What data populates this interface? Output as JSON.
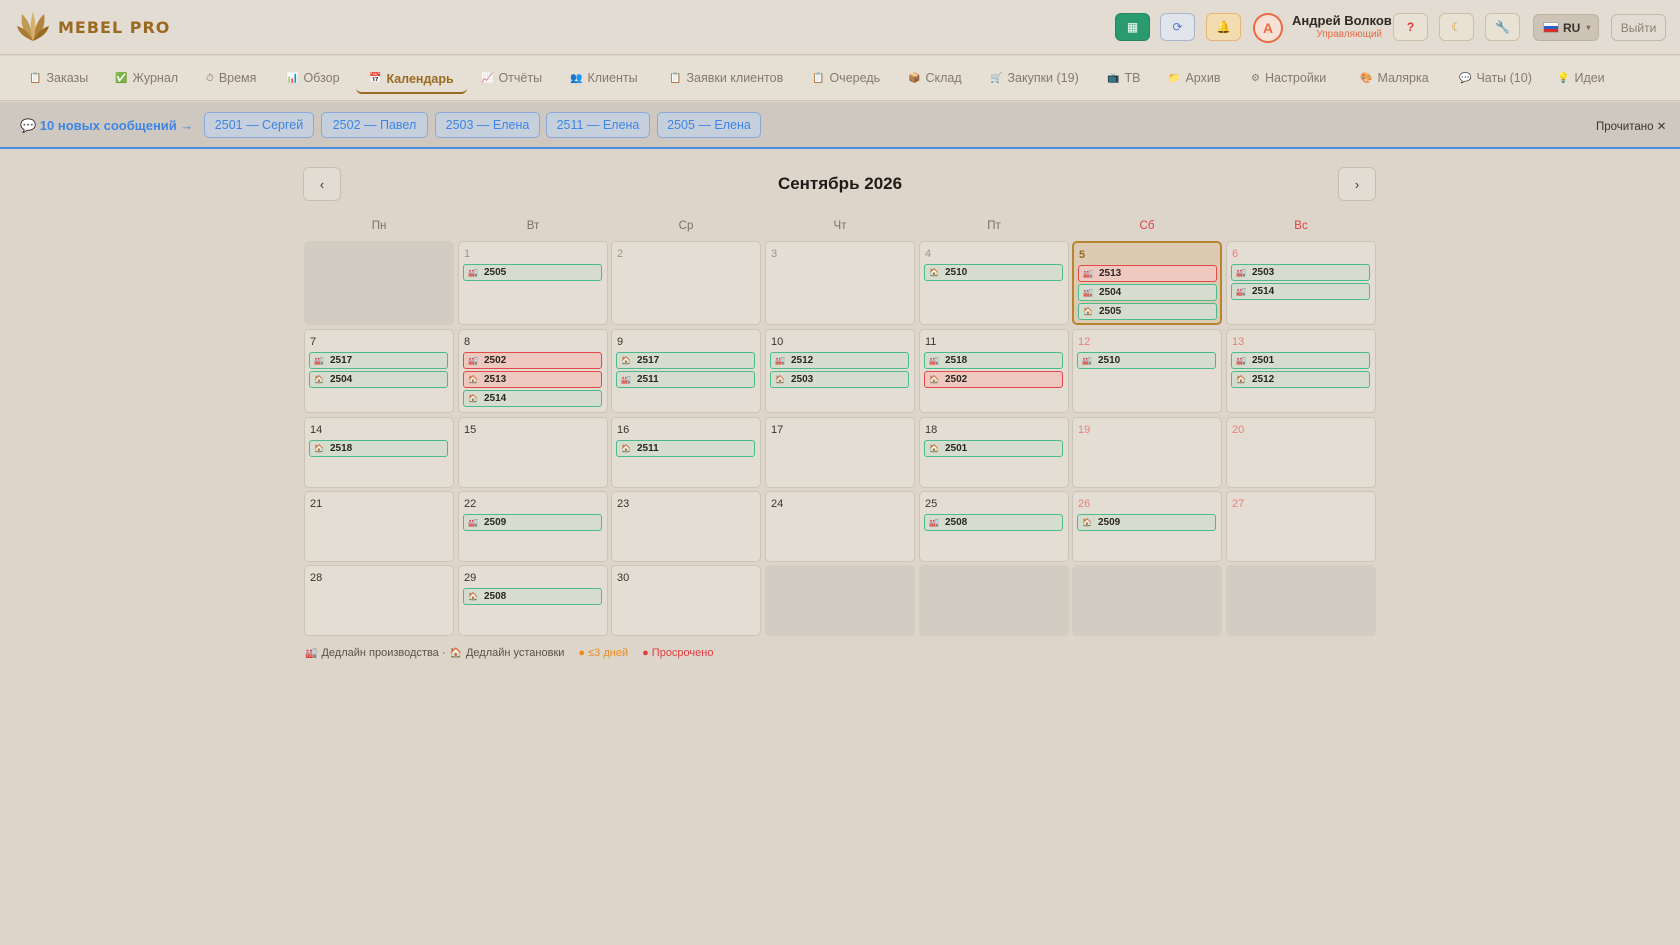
{
  "header": {
    "logo_text": "MEBEL PRO",
    "buttons": [
      {
        "icon": "grid-icon"
      },
      {
        "icon": "refresh-icon"
      },
      {
        "icon": "bell-icon"
      }
    ],
    "avatar_letter": "А",
    "user_name": "Андрей Волков",
    "user_role": "Управляющий",
    "help_icon": "?",
    "lang": "RU",
    "logout": "Выйти"
  },
  "nav": [
    {
      "label": "Заказы",
      "icon": "📋"
    },
    {
      "label": "Журнал",
      "icon": "✅"
    },
    {
      "label": "Время",
      "icon": "⏱"
    },
    {
      "label": "Обзор",
      "icon": "📊"
    },
    {
      "label": "Календарь",
      "icon": "📅"
    },
    {
      "label": "Отчёты",
      "icon": "📈"
    },
    {
      "label": "Клиенты",
      "icon": "👥"
    },
    {
      "label": "Заявки клиентов",
      "icon": "📋"
    },
    {
      "label": "Очередь",
      "icon": "📋"
    },
    {
      "label": "Склад",
      "icon": "📦"
    },
    {
      "label": "Закупки (19)",
      "icon": "🛒"
    },
    {
      "label": "ТВ",
      "icon": "📺"
    },
    {
      "label": "Архив",
      "icon": "📁"
    },
    {
      "label": "Настройки",
      "icon": "⚙"
    },
    {
      "label": "Малярка",
      "icon": "🎨"
    },
    {
      "label": "Чаты (10)",
      "icon": "💬"
    },
    {
      "label": "Идеи",
      "icon": "💡"
    }
  ],
  "messages": {
    "headline": "💬 10 новых сообщений →",
    "chips": [
      "2501 — Сергей",
      "2502 — Павел",
      "2503 — Елена",
      "2511 — Елена",
      "2505 — Елена"
    ],
    "mark_read": "Прочитано"
  },
  "calendar": {
    "title": "Сентябрь 2026",
    "prev": "‹",
    "next": "›",
    "weekdays": [
      "Пн",
      "Вт",
      "Ср",
      "Чт",
      "Пт",
      "Сб",
      "Вс"
    ],
    "weeks": [
      [
        null,
        {
          "day": "1",
          "past": true,
          "events": [
            {
              "num": "2505",
              "type": "production"
            }
          ]
        },
        {
          "day": "2",
          "past": true,
          "events": []
        },
        {
          "day": "3",
          "past": true,
          "events": []
        },
        {
          "day": "4",
          "past": true,
          "events": [
            {
              "num": "2510",
              "type": "install"
            }
          ]
        },
        {
          "day": "5",
          "today": true,
          "events": [
            {
              "num": "2513",
              "type": "production",
              "overdue": true
            },
            {
              "num": "2504",
              "type": "production"
            },
            {
              "num": "2505",
              "type": "install"
            }
          ]
        },
        {
          "day": "6",
          "weekend": true,
          "events": [
            {
              "num": "2503",
              "type": "production"
            },
            {
              "num": "2514",
              "type": "production"
            }
          ]
        }
      ],
      [
        {
          "day": "7",
          "events": [
            {
              "num": "2517",
              "type": "production"
            },
            {
              "num": "2504",
              "type": "install"
            }
          ]
        },
        {
          "day": "8",
          "events": [
            {
              "num": "2502",
              "type": "production",
              "overdue": true
            },
            {
              "num": "2513",
              "type": "install",
              "overdue": true
            },
            {
              "num": "2514",
              "type": "install"
            }
          ]
        },
        {
          "day": "9",
          "events": [
            {
              "num": "2517",
              "type": "install"
            },
            {
              "num": "2511",
              "type": "production"
            }
          ]
        },
        {
          "day": "10",
          "events": [
            {
              "num": "2512",
              "type": "production"
            },
            {
              "num": "2503",
              "type": "install"
            }
          ]
        },
        {
          "day": "11",
          "events": [
            {
              "num": "2518",
              "type": "production"
            },
            {
              "num": "2502",
              "type": "install",
              "overdue": true
            }
          ]
        },
        {
          "day": "12",
          "weekend": true,
          "events": [
            {
              "num": "2510",
              "type": "production"
            }
          ]
        },
        {
          "day": "13",
          "weekend": true,
          "events": [
            {
              "num": "2501",
              "type": "production"
            },
            {
              "num": "2512",
              "type": "install"
            }
          ]
        }
      ],
      [
        {
          "day": "14",
          "events": [
            {
              "num": "2518",
              "type": "install"
            }
          ]
        },
        {
          "day": "15",
          "events": []
        },
        {
          "day": "16",
          "events": [
            {
              "num": "2511",
              "type": "install"
            }
          ]
        },
        {
          "day": "17",
          "events": []
        },
        {
          "day": "18",
          "events": [
            {
              "num": "2501",
              "type": "install"
            }
          ]
        },
        {
          "day": "19",
          "weekend": true,
          "events": []
        },
        {
          "day": "20",
          "weekend": true,
          "events": []
        }
      ],
      [
        {
          "day": "21",
          "events": []
        },
        {
          "day": "22",
          "events": [
            {
              "num": "2509",
              "type": "production"
            }
          ]
        },
        {
          "day": "23",
          "events": []
        },
        {
          "day": "24",
          "events": []
        },
        {
          "day": "25",
          "events": [
            {
              "num": "2508",
              "type": "production"
            }
          ]
        },
        {
          "day": "26",
          "weekend": true,
          "events": [
            {
              "num": "2509",
              "type": "install"
            }
          ]
        },
        {
          "day": "27",
          "weekend": true,
          "events": []
        }
      ],
      [
        {
          "day": "28",
          "events": []
        },
        {
          "day": "29",
          "events": [
            {
              "num": "2508",
              "type": "install"
            }
          ]
        },
        {
          "day": "30",
          "events": []
        },
        null,
        null,
        null,
        null
      ]
    ]
  },
  "legend": {
    "production": "Дедлайн производства ·",
    "install": "Дедлайн установки",
    "soon": "● ≤3 дней",
    "overdue": "● Просрочено"
  },
  "icons": {
    "production": "🏭",
    "install": "🏠"
  },
  "colors": {
    "accent": "#9b6a22",
    "link": "#3d86e6",
    "ok": "#4bbb8c",
    "overdue": "#e04a4a",
    "soon": "#f08a1c"
  }
}
